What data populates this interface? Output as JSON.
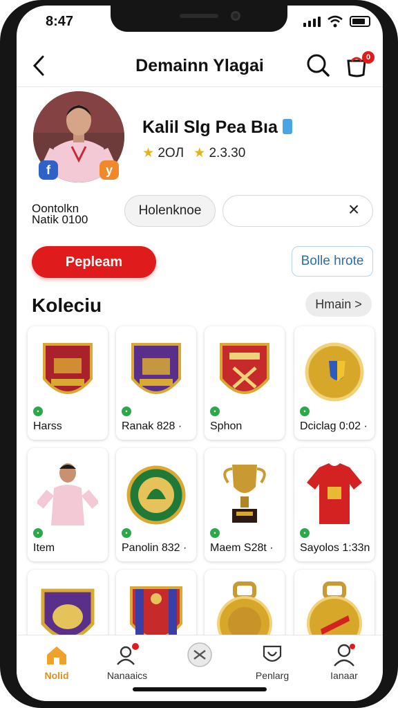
{
  "status": {
    "time": "8:47"
  },
  "header": {
    "title": "Demainn Ylagai",
    "back_icon": "chevron-left-icon",
    "search_icon": "search-icon",
    "bag_icon": "shopping-bag-icon",
    "bag_badge": "0"
  },
  "profile": {
    "name": "Kalil Slg Pea Bıa",
    "stat1": "2OЛ",
    "stat2": "2.3.30",
    "social": {
      "facebook": "f",
      "other": "y"
    }
  },
  "filters": {
    "label_line1": "Oontolkn",
    "label_line2": "Natik 0100",
    "chip_label": "Holenknoe",
    "search_value": "",
    "search_placeholder": ""
  },
  "actions": {
    "primary_label": "Pepleam",
    "secondary_label": "Bolle hrote"
  },
  "collection": {
    "title": "Koleciu",
    "see_all": "Hmain >",
    "items": [
      {
        "label": "Harss",
        "kind": "crest-red"
      },
      {
        "label": "Ranak 828 ·",
        "kind": "crest-purple"
      },
      {
        "label": "Sphon",
        "kind": "crest-red2"
      },
      {
        "label": "Dciclag 0:02 ·",
        "kind": "medal-gold"
      },
      {
        "label": "Item",
        "kind": "player"
      },
      {
        "label": "Panolin 832 ·",
        "kind": "crest-green"
      },
      {
        "label": "Maem S28t ·",
        "kind": "trophy"
      },
      {
        "label": "Sayolos 1:33n",
        "kind": "jersey"
      },
      {
        "label": "",
        "kind": "crest-purple2"
      },
      {
        "label": "",
        "kind": "crest-stripe"
      },
      {
        "label": "",
        "kind": "medal-gold2"
      },
      {
        "label": "",
        "kind": "medal-red"
      }
    ]
  },
  "tabbar": {
    "tabs": [
      {
        "label": "Nolid",
        "icon": "home-icon"
      },
      {
        "label": "Nanaaics",
        "icon": "profile-notify-icon"
      },
      {
        "label": "",
        "icon": "center-action-icon"
      },
      {
        "label": "Penlarg",
        "icon": "heart-shield-icon"
      },
      {
        "label": "Ianaar",
        "icon": "user-icon"
      }
    ]
  },
  "colors": {
    "accent": "#e01b1b",
    "active_tab": "#e0901a",
    "link": "#2b6fad"
  }
}
